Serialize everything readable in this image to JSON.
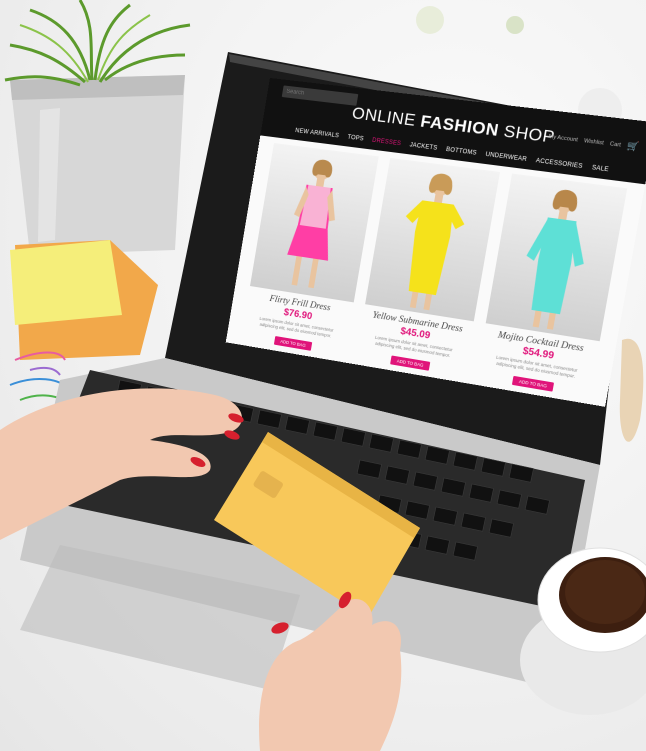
{
  "shop": {
    "brand_light": "ONLINE ",
    "brand_bold": "FASHION",
    "brand_tail": " SHOP",
    "search_placeholder": "Search",
    "account_links": [
      "My Account",
      "Wishlist",
      "Cart"
    ],
    "menu": [
      "New Arrivals",
      "Tops",
      "Dresses",
      "Jackets",
      "Bottoms",
      "Underwear",
      "Accessories",
      "Sale"
    ],
    "active_menu": "Dresses",
    "products": [
      {
        "name": "Flirty Frill Dress",
        "price": "$76.90",
        "description": "Lorem ipsum dolor sit amet, consectetur adipiscing elit, sed do eiusmod tempor.",
        "button": "ADD TO BAG",
        "dress_color": "#ff3ea5"
      },
      {
        "name": "Yellow Submarine Dress",
        "price": "$45.09",
        "description": "Lorem ipsum dolor sit amet, consectetur adipiscing elit, sed do eiusmod tempor.",
        "button": "ADD TO BAG",
        "dress_color": "#f5e21b"
      },
      {
        "name": "Mojito Cocktail Dress",
        "price": "$54.99",
        "description": "Lorem ipsum dolor sit amet, consectetur adipiscing elit, sed do eiusmod tempor.",
        "button": "ADD TO BAG",
        "dress_color": "#5ee0d6"
      }
    ]
  },
  "colors": {
    "accent": "#e0147a",
    "nav_bg": "#111111",
    "card_yellow": "#f8c85a",
    "sticky_note": "#f5ee7a",
    "nail_polish": "#d6202e"
  }
}
